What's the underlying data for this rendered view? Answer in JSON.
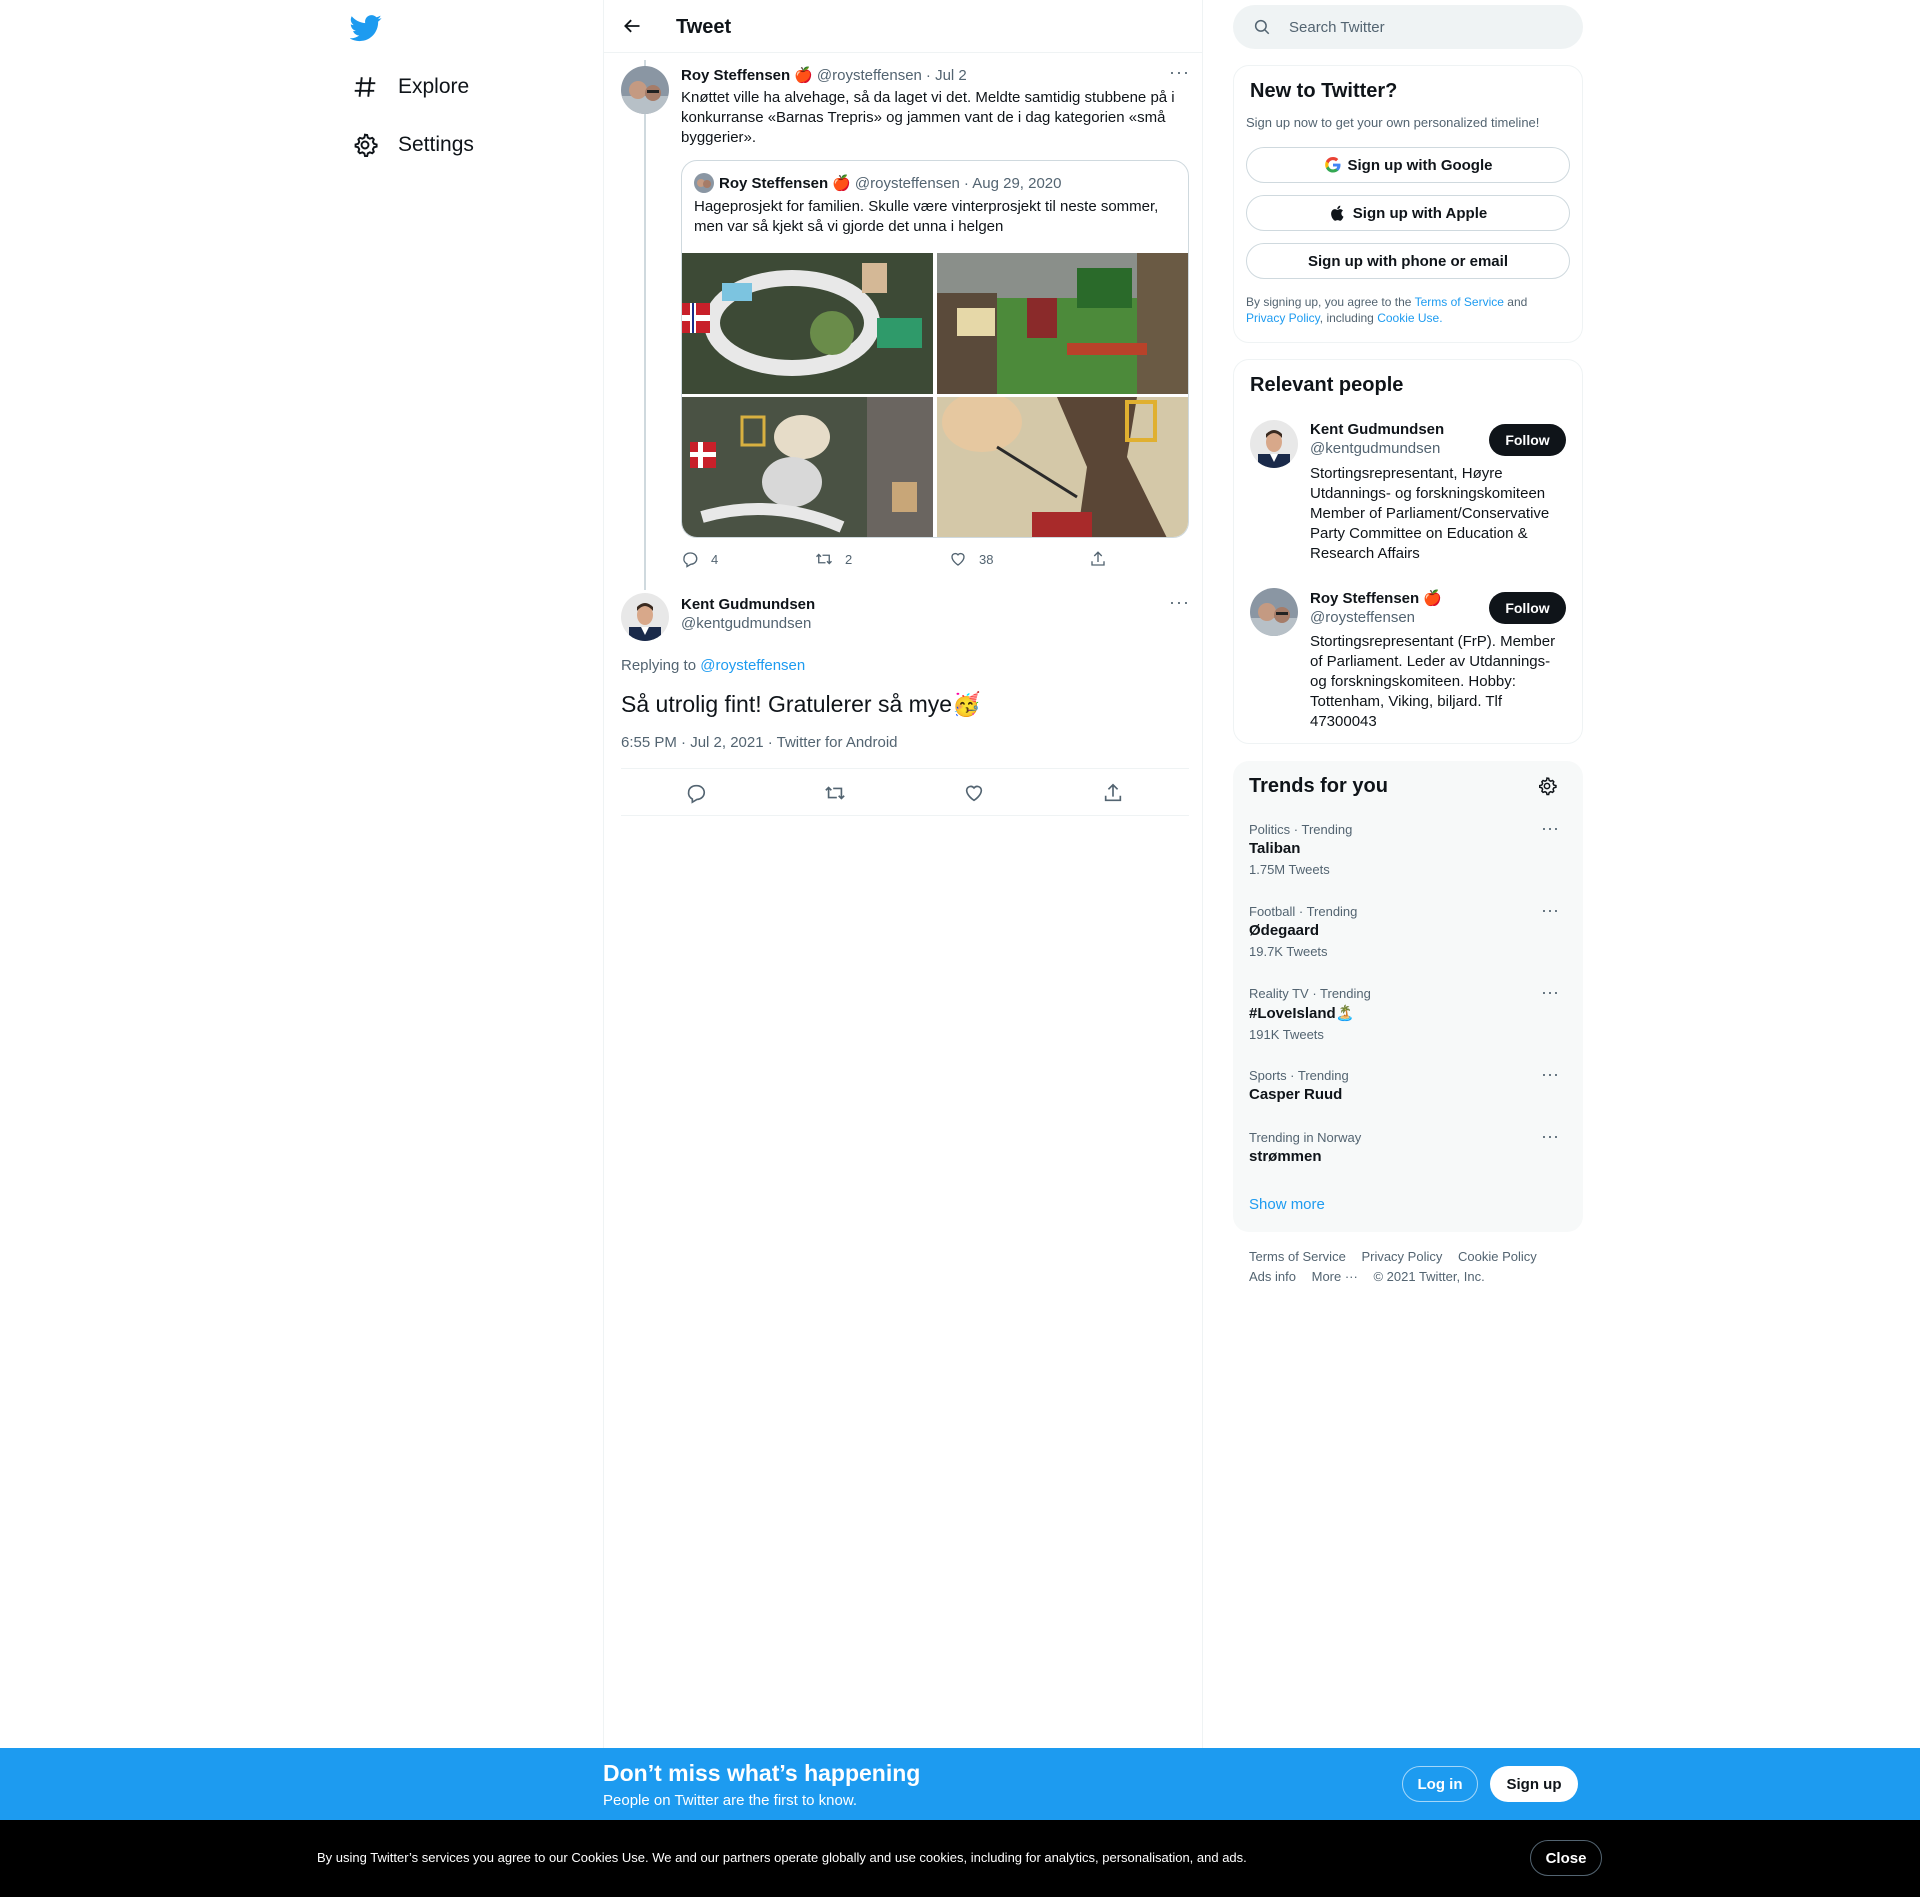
{
  "nav": {
    "explore_label": "Explore",
    "settings_label": "Settings"
  },
  "header": {
    "title": "Tweet"
  },
  "parent_tweet": {
    "name": "Roy Steffensen",
    "badge": "🍎",
    "handle": "@roysteffensen",
    "date": "· Jul 2",
    "text": "Knøttet ville ha alvehage, så da laget vi det. Meldte samtidig stubbene på i konkurranse «Barnas Trepris» og jammen vant de i dag kategorien «små byggerier».",
    "quote": {
      "name": "Roy Steffensen",
      "badge": "🍎",
      "handle": "@roysteffensen",
      "date": "· Aug 29, 2020",
      "text": "Hageprosjekt for familien. Skulle være vinterprosjekt til neste sommer, men var så kjekt så vi gjorde det unna i helgen"
    },
    "replies": "4",
    "retweets": "2",
    "likes": "38"
  },
  "main_tweet": {
    "name": "Kent Gudmundsen",
    "handle": "@kentgudmundsen",
    "replying_label": "Replying to",
    "replying_handle": "@roysteffensen",
    "text": "Så utrolig fint! Gratulerer så mye",
    "emoji": "🥳",
    "timestamp": "6:55 PM · Jul 2, 2021 · Twitter for Android"
  },
  "search": {
    "placeholder": "Search Twitter"
  },
  "signup": {
    "title": "New to Twitter?",
    "subtitle": "Sign up now to get your own personalized timeline!",
    "google": "Sign up with Google",
    "apple": "Sign up with Apple",
    "phone": "Sign up with phone or email",
    "legal_1": "By signing up, you agree to the",
    "tos": "Terms of Service",
    "legal_2": "and",
    "privacy": "Privacy Policy",
    "legal_3": ", including",
    "cookie": "Cookie Use."
  },
  "relevant": {
    "title": "Relevant people",
    "people": [
      {
        "name": "Kent Gudmundsen",
        "badge": "",
        "handle": "@kentgudmundsen",
        "bio": "Stortingsrepresentant, Høyre Utdannings- og forskningskomiteen Member of Parliament/Conservative Party Committee on Education & Research Affairs",
        "follow": "Follow"
      },
      {
        "name": "Roy Steffensen",
        "badge": "🍎",
        "handle": "@roysteffensen",
        "bio": "Stortingsrepresentant (FrP). Member of Parliament. Leder av Utdannings- og forskningskomiteen. Hobby: Tottenham, Viking, biljard. Tlf 47300043",
        "follow": "Follow"
      }
    ]
  },
  "trends": {
    "title": "Trends for you",
    "items": [
      {
        "meta": "Politics · Trending",
        "title": "Taliban",
        "count": "1.75M Tweets"
      },
      {
        "meta": "Football · Trending",
        "title": "Ødegaard",
        "count": "19.7K Tweets"
      },
      {
        "meta": "Reality TV · Trending",
        "title": "#LoveIsland🏝️",
        "count": "191K Tweets"
      },
      {
        "meta": "Sports · Trending",
        "title": "Casper Ruud",
        "count": ""
      },
      {
        "meta": "Trending in Norway",
        "title": "strømmen",
        "count": ""
      }
    ],
    "show_more": "Show more"
  },
  "footer": {
    "tos": "Terms of Service",
    "privacy": "Privacy Policy",
    "cookie": "Cookie Policy",
    "ads": "Ads info",
    "more": "More ···",
    "copyright": "© 2021 Twitter, Inc."
  },
  "banner": {
    "title": "Don’t miss what’s happening",
    "subtitle": "People on Twitter are the first to know.",
    "login": "Log in",
    "signup": "Sign up"
  },
  "cookie_bar": {
    "text": "By using Twitter’s services you agree to our Cookies Use. We and our partners operate globally and use cookies, including for analytics, personalisation, and ads.",
    "close": "Close"
  },
  "colors": {
    "accent": "#1d9bf0",
    "text": "#0f1419",
    "secondary": "#536471",
    "border": "#eff3f4"
  }
}
